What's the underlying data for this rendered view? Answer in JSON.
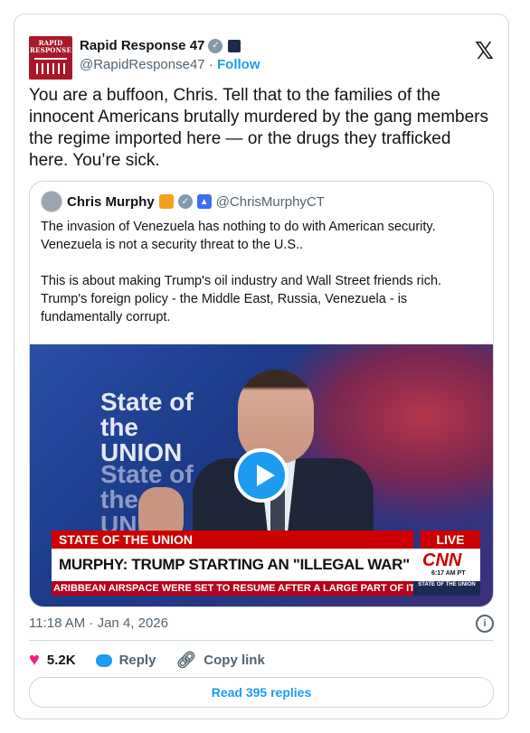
{
  "post": {
    "avatar_text": "RAPID RESPONSE",
    "author_name": "Rapid Response 47",
    "handle": "@RapidResponse47",
    "separator": "·",
    "follow_label": "Follow",
    "x_logo": "𝕏",
    "text": "You are a buffoon, Chris. Tell that to the families of the innocent Americans brutally murdered by the gang members the regime imported here — or the drugs they trafficked here. You’re sick.",
    "timestamp": "11:18 AM · Jan 4, 2026",
    "info_icon": "i"
  },
  "quote": {
    "author_name": "Chris Murphy",
    "handle": "@ChrisMurphyCT",
    "paragraphs": [
      "The invasion of Venezuela has nothing to do with American security. Venezuela is not a security threat to the U.S..",
      "This is about making Trump's oil industry and Wall Street friends rich. Trump's foreign policy - the Middle East, Russia, Venezuela - is fundamentally corrupt."
    ],
    "video": {
      "lower_third_top": "STATE OF THE UNION",
      "live_label": "LIVE",
      "headline": "MURPHY: TRUMP STARTING AN \"ILLEGAL WAR\" IN VENEZUELA",
      "network": "CNN",
      "time": "6:17 AM PT",
      "ticker": "ARIBBEAN AIRSPACE WERE SET TO RESUME AFTER A LARGE PART OF IT WAS CLOSED AF",
      "show_badge": "STATE OF THE UNION",
      "backdrop_text_1": "State of the UNION",
      "backdrop_text_2": "State of the UNION"
    }
  },
  "actions": {
    "likes": "5.2K",
    "reply_label": "Reply",
    "copy_link_label": "Copy link",
    "read_replies_label": "Read 395 replies"
  },
  "colors": {
    "accent": "#1d9bf0",
    "like": "#f91880",
    "cnn_red": "#cc0000"
  }
}
